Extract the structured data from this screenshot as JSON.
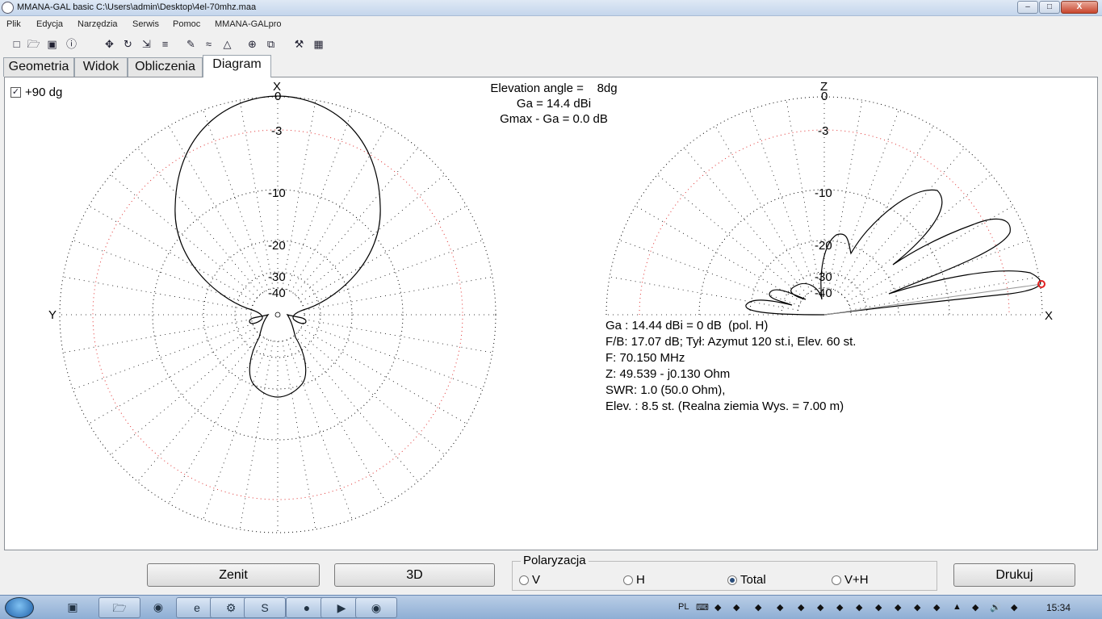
{
  "window": {
    "title": "MMANA-GAL basic C:\\Users\\admin\\Desktop\\4el-70mhz.maa",
    "min_label": "–",
    "max_label": "□",
    "close_label": "X"
  },
  "menu": [
    "Plik",
    "Edycja",
    "Narzędzia",
    "Serwis",
    "Pomoc",
    "MMANA-GALpro"
  ],
  "toolbar_icons": [
    "new-file-icon",
    "open-folder-icon",
    "save-icon",
    "info-icon",
    "move-icon",
    "rotate-icon",
    "scale-icon",
    "mirror-icon",
    "draw-icon",
    "wire-icon",
    "triangle-icon",
    "target-icon",
    "copy-icon",
    "tools-icon",
    "calculator-icon"
  ],
  "tabs": [
    {
      "label": "Geometria",
      "active": false
    },
    {
      "label": "Widok",
      "active": false
    },
    {
      "label": "Obliczenia",
      "active": false
    },
    {
      "label": "Diagram",
      "active": true
    }
  ],
  "diagram": {
    "checkbox_label": "+90 dg",
    "checkbox_checked": "✓",
    "horizontal": {
      "top_axis": "X",
      "left_axis": "Y",
      "ring_labels": [
        "0",
        "-3",
        "-10",
        "-20",
        "-30",
        "-40"
      ]
    },
    "vertical": {
      "top_axis": "Z",
      "right_axis": "X",
      "ring_labels": [
        "0",
        "-3",
        "-10",
        "-20",
        "-30",
        "-40"
      ]
    },
    "center_info": [
      "Elevation angle =    8dg",
      "Ga = 14.4 dBi",
      "Gmax - Ga = 0.0 dB"
    ],
    "results": [
      "Ga : 14.44 dBi = 0 dB  (pol. H)",
      "F/B: 17.07 dB; Tył: Azymut 120 st.i, Elev. 60 st.",
      "F: 70.150 MHz",
      "Z: 49.539 - j0.130 Ohm",
      "SWR: 1.0 (50.0 Ohm),",
      "Elev. : 8.5 st. (Realna ziemia Wys. = 7.00 m)"
    ]
  },
  "bottom": {
    "zenit_label": "Zenit",
    "3d_label": "3D",
    "polarization_title": "Polaryzacja",
    "radios": [
      {
        "label": "V",
        "selected": false
      },
      {
        "label": "H",
        "selected": false
      },
      {
        "label": "Total",
        "selected": true
      },
      {
        "label": "V+H",
        "selected": false
      }
    ],
    "print_label": "Drukuj"
  },
  "taskbar": {
    "lang": "PL",
    "time": "15:34"
  },
  "colors": {
    "plot_line": "#000000",
    "grid_dotted": "#000000",
    "ring_red": "#e03030",
    "marker": "#e02020",
    "panel_bg": "#ffffff"
  }
}
